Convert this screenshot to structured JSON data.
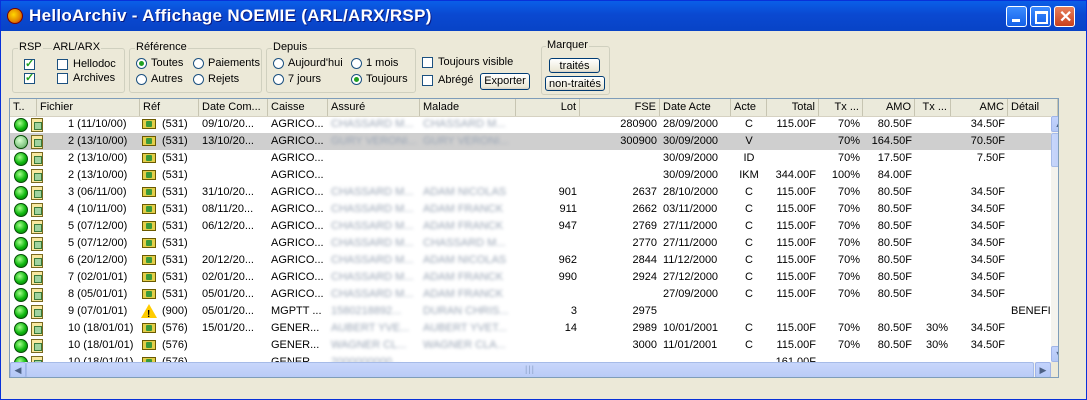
{
  "window": {
    "title": "HelloArchiv - Affichage NOEMIE (ARL/ARX/RSP)"
  },
  "filters": {
    "rsp": {
      "title": "RSP",
      "checked": true
    },
    "arl_arx": {
      "title": "ARL/ARX",
      "checked": true
    },
    "hellodoc": {
      "label": "Hellodoc",
      "checked": false
    },
    "archives": {
      "label": "Archives",
      "checked": false
    },
    "reference": {
      "title": "Référence",
      "options": [
        {
          "label": "Toutes",
          "checked": true
        },
        {
          "label": "Paiements",
          "checked": false
        },
        {
          "label": "Autres",
          "checked": false
        },
        {
          "label": "Rejets",
          "checked": false
        }
      ]
    },
    "depuis": {
      "title": "Depuis",
      "options": [
        {
          "label": "Aujourd'hui",
          "checked": false
        },
        {
          "label": "1 mois",
          "checked": false
        },
        {
          "label": "7 jours",
          "checked": false
        },
        {
          "label": "Toujours",
          "checked": true
        }
      ]
    },
    "toujours_visible": {
      "label": "Toujours visible",
      "checked": false
    },
    "abrege": {
      "label": "Abrégé",
      "checked": false
    },
    "exporter_label": "Exporter",
    "marquer": {
      "title": "Marquer",
      "traites_label": "traités",
      "non_traites_label": "non-traités"
    }
  },
  "columns": [
    "T..",
    "Fichier",
    "Réf",
    "Date Com...",
    "Caisse",
    "Assuré",
    "Malade",
    "Lot",
    "FSE",
    "Date Acte",
    "Acte",
    "Total",
    "Tx ...",
    "AMO",
    "Tx ...",
    "AMC",
    "Détail"
  ],
  "rows": [
    {
      "fichier": "1 (11/10/00)",
      "ref": "(531)",
      "ref_icon": "payment",
      "date_com": "09/10/20...",
      "caisse": "AGRICO...",
      "assure": "CHASSARD M...",
      "malade": "CHASSARD M...",
      "lot": "",
      "fse": "280900",
      "date_acte": "28/09/2000",
      "acte": "C",
      "total": "115.00F",
      "tx1": "70%",
      "amo": "80.50F",
      "tx2": "",
      "amc": "34.50F",
      "detail": "",
      "selected": false
    },
    {
      "fichier": "2 (13/10/00)",
      "ref": "(531)",
      "ref_icon": "payment",
      "date_com": "13/10/20...",
      "caisse": "AGRICO...",
      "assure": "GURY VERONI...",
      "malade": "GURY VERONI...",
      "lot": "",
      "fse": "300900",
      "date_acte": "30/09/2000",
      "acte": "V",
      "total": "",
      "tx1": "70%",
      "amo": "164.50F",
      "tx2": "",
      "amc": "70.50F",
      "detail": "",
      "selected": true
    },
    {
      "fichier": "2 (13/10/00)",
      "ref": "(531)",
      "ref_icon": "payment",
      "date_com": "",
      "caisse": "AGRICO...",
      "assure": "",
      "malade": "",
      "lot": "",
      "fse": "",
      "date_acte": "30/09/2000",
      "acte": "ID",
      "total": "",
      "tx1": "70%",
      "amo": "17.50F",
      "tx2": "",
      "amc": "7.50F",
      "detail": "",
      "selected": false
    },
    {
      "fichier": "2 (13/10/00)",
      "ref": "(531)",
      "ref_icon": "payment",
      "date_com": "",
      "caisse": "AGRICO...",
      "assure": "",
      "malade": "",
      "lot": "",
      "fse": "",
      "date_acte": "30/09/2000",
      "acte": "IKM",
      "total": "344.00F",
      "tx1": "100%",
      "amo": "84.00F",
      "tx2": "",
      "amc": "",
      "detail": "",
      "selected": false
    },
    {
      "fichier": "3 (06/11/00)",
      "ref": "(531)",
      "ref_icon": "payment",
      "date_com": "31/10/20...",
      "caisse": "AGRICO...",
      "assure": "CHASSARD M...",
      "malade": "ADAM NICOLAS",
      "lot": "901",
      "fse": "2637",
      "date_acte": "28/10/2000",
      "acte": "C",
      "total": "115.00F",
      "tx1": "70%",
      "amo": "80.50F",
      "tx2": "",
      "amc": "34.50F",
      "detail": "",
      "selected": false
    },
    {
      "fichier": "4 (10/11/00)",
      "ref": "(531)",
      "ref_icon": "payment",
      "date_com": "08/11/20...",
      "caisse": "AGRICO...",
      "assure": "CHASSARD M...",
      "malade": "ADAM FRANCK",
      "lot": "911",
      "fse": "2662",
      "date_acte": "03/11/2000",
      "acte": "C",
      "total": "115.00F",
      "tx1": "70%",
      "amo": "80.50F",
      "tx2": "",
      "amc": "34.50F",
      "detail": "",
      "selected": false
    },
    {
      "fichier": "5 (07/12/00)",
      "ref": "(531)",
      "ref_icon": "payment",
      "date_com": "06/12/20...",
      "caisse": "AGRICO...",
      "assure": "CHASSARD M...",
      "malade": "ADAM FRANCK",
      "lot": "947",
      "fse": "2769",
      "date_acte": "27/11/2000",
      "acte": "C",
      "total": "115.00F",
      "tx1": "70%",
      "amo": "80.50F",
      "tx2": "",
      "amc": "34.50F",
      "detail": "",
      "selected": false
    },
    {
      "fichier": "5 (07/12/00)",
      "ref": "(531)",
      "ref_icon": "payment",
      "date_com": "",
      "caisse": "AGRICO...",
      "assure": "CHASSARD M...",
      "malade": "CHASSARD M...",
      "lot": "",
      "fse": "2770",
      "date_acte": "27/11/2000",
      "acte": "C",
      "total": "115.00F",
      "tx1": "70%",
      "amo": "80.50F",
      "tx2": "",
      "amc": "34.50F",
      "detail": "",
      "selected": false
    },
    {
      "fichier": "6 (20/12/00)",
      "ref": "(531)",
      "ref_icon": "payment",
      "date_com": "20/12/20...",
      "caisse": "AGRICO...",
      "assure": "CHASSARD M...",
      "malade": "ADAM NICOLAS",
      "lot": "962",
      "fse": "2844",
      "date_acte": "11/12/2000",
      "acte": "C",
      "total": "115.00F",
      "tx1": "70%",
      "amo": "80.50F",
      "tx2": "",
      "amc": "34.50F",
      "detail": "",
      "selected": false
    },
    {
      "fichier": "7 (02/01/01)",
      "ref": "(531)",
      "ref_icon": "payment",
      "date_com": "02/01/20...",
      "caisse": "AGRICO...",
      "assure": "CHASSARD M...",
      "malade": "ADAM FRANCK",
      "lot": "990",
      "fse": "2924",
      "date_acte": "27/12/2000",
      "acte": "C",
      "total": "115.00F",
      "tx1": "70%",
      "amo": "80.50F",
      "tx2": "",
      "amc": "34.50F",
      "detail": "",
      "selected": false
    },
    {
      "fichier": "8 (05/01/01)",
      "ref": "(531)",
      "ref_icon": "payment",
      "date_com": "05/01/20...",
      "caisse": "AGRICO...",
      "assure": "CHASSARD M...",
      "malade": "ADAM FRANCK",
      "lot": "",
      "fse": "",
      "date_acte": "27/09/2000",
      "acte": "C",
      "total": "115.00F",
      "tx1": "70%",
      "amo": "80.50F",
      "tx2": "",
      "amc": "34.50F",
      "detail": "",
      "selected": false
    },
    {
      "fichier": "9 (07/01/01)",
      "ref": "(900)",
      "ref_icon": "warning",
      "date_com": "05/01/20...",
      "caisse": "MGPTT ...",
      "assure": "1580218892...",
      "malade": "DURAN CHRIS...",
      "lot": "3",
      "fse": "2975",
      "date_acte": "",
      "acte": "",
      "total": "",
      "tx1": "",
      "amo": "",
      "tx2": "",
      "amc": "",
      "detail": "BENEFIC",
      "selected": false
    },
    {
      "fichier": "10 (18/01/01)",
      "ref": "(576)",
      "ref_icon": "payment",
      "date_com": "15/01/20...",
      "caisse": "GENER...",
      "assure": "AUBERT YVE...",
      "malade": "AUBERT YVET...",
      "lot": "14",
      "fse": "2989",
      "date_acte": "10/01/2001",
      "acte": "C",
      "total": "115.00F",
      "tx1": "70%",
      "amo": "80.50F",
      "tx2": "30%",
      "amc": "34.50F",
      "detail": "",
      "selected": false
    },
    {
      "fichier": "10 (18/01/01)",
      "ref": "(576)",
      "ref_icon": "payment",
      "date_com": "",
      "caisse": "GENER...",
      "assure": "WAGNER CL...",
      "malade": "WAGNER CLA...",
      "lot": "",
      "fse": "3000",
      "date_acte": "11/01/2001",
      "acte": "C",
      "total": "115.00F",
      "tx1": "70%",
      "amo": "80.50F",
      "tx2": "30%",
      "amc": "34.50F",
      "detail": "",
      "selected": false
    },
    {
      "fichier": "10 (18/01/01)",
      "ref": "(576)",
      "ref_icon": "payment",
      "date_com": "",
      "caisse": "GENER...",
      "assure": "2000000000...",
      "malade": "",
      "lot": "",
      "fse": "",
      "date_acte": "",
      "acte": "",
      "total": "161.00F",
      "tx1": "",
      "amo": "",
      "tx2": "",
      "amc": "",
      "detail": "",
      "selected": false
    }
  ]
}
